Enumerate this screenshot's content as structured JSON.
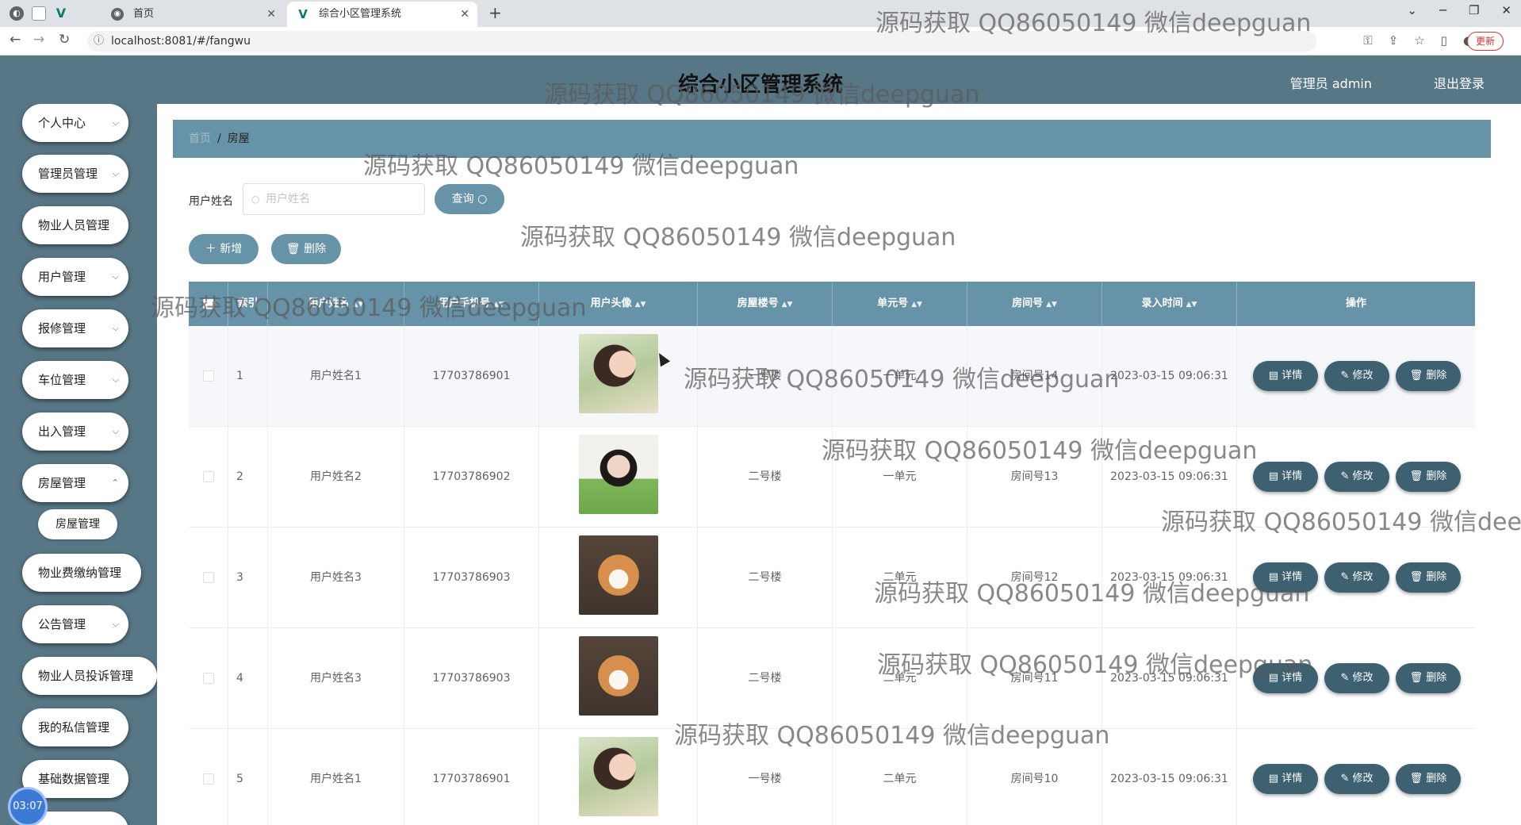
{
  "browser": {
    "tabs": [
      {
        "label": "首页"
      },
      {
        "label": "综合小区管理系统"
      }
    ],
    "url": "localhost:8081/#/fangwu",
    "update_label": "更新"
  },
  "header": {
    "title": "综合小区管理系统",
    "admin": "管理员 admin",
    "logout": "退出登录"
  },
  "sidebar": {
    "items": [
      {
        "label": "个人中心"
      },
      {
        "label": "管理员管理"
      },
      {
        "label": "物业人员管理"
      },
      {
        "label": "用户管理"
      },
      {
        "label": "报修管理"
      },
      {
        "label": "车位管理"
      },
      {
        "label": "出入管理"
      },
      {
        "label": "房屋管理"
      },
      {
        "label": "物业费缴纳管理"
      },
      {
        "label": "公告管理"
      },
      {
        "label": "物业人员投诉管理"
      },
      {
        "label": "我的私信管理"
      },
      {
        "label": "基础数据管理"
      }
    ],
    "submenu": {
      "label": "房屋管理"
    },
    "timer": "03:07"
  },
  "breadcrumb": {
    "home": "首页",
    "current": "房屋"
  },
  "search": {
    "label": "用户姓名",
    "placeholder": "用户姓名",
    "query_label": "查询"
  },
  "toolbar": {
    "add_label": "新增",
    "delete_label": "删除"
  },
  "table": {
    "headers": [
      "索引",
      "用户姓名",
      "用户手机号",
      "用户头像",
      "房屋楼号",
      "单元号",
      "房间号",
      "录入时间",
      "操作"
    ],
    "rows": [
      {
        "index": "1",
        "name": "用户姓名1",
        "phone": "17703786901",
        "building": "一号楼",
        "unit": "一单元",
        "room": "房间号14",
        "time": "2023-03-15 09:06:31"
      },
      {
        "index": "2",
        "name": "用户姓名2",
        "phone": "17703786902",
        "building": "二号楼",
        "unit": "一单元",
        "room": "房间号13",
        "time": "2023-03-15 09:06:31"
      },
      {
        "index": "3",
        "name": "用户姓名3",
        "phone": "17703786903",
        "building": "二号楼",
        "unit": "二单元",
        "room": "房间号12",
        "time": "2023-03-15 09:06:31"
      },
      {
        "index": "4",
        "name": "用户姓名3",
        "phone": "17703786903",
        "building": "二号楼",
        "unit": "二单元",
        "room": "房间号11",
        "time": "2023-03-15 09:06:31"
      },
      {
        "index": "5",
        "name": "用户姓名1",
        "phone": "17703786901",
        "building": "一号楼",
        "unit": "二单元",
        "room": "房间号10",
        "time": "2023-03-15 09:06:31"
      }
    ],
    "actions": {
      "detail": "详情",
      "edit": "修改",
      "delete": "删除"
    }
  },
  "watermark": "源码获取 QQ86050149 微信deepguan",
  "colors": {
    "primary": "#6693a7",
    "header": "#587786",
    "action": "#3d6171"
  }
}
